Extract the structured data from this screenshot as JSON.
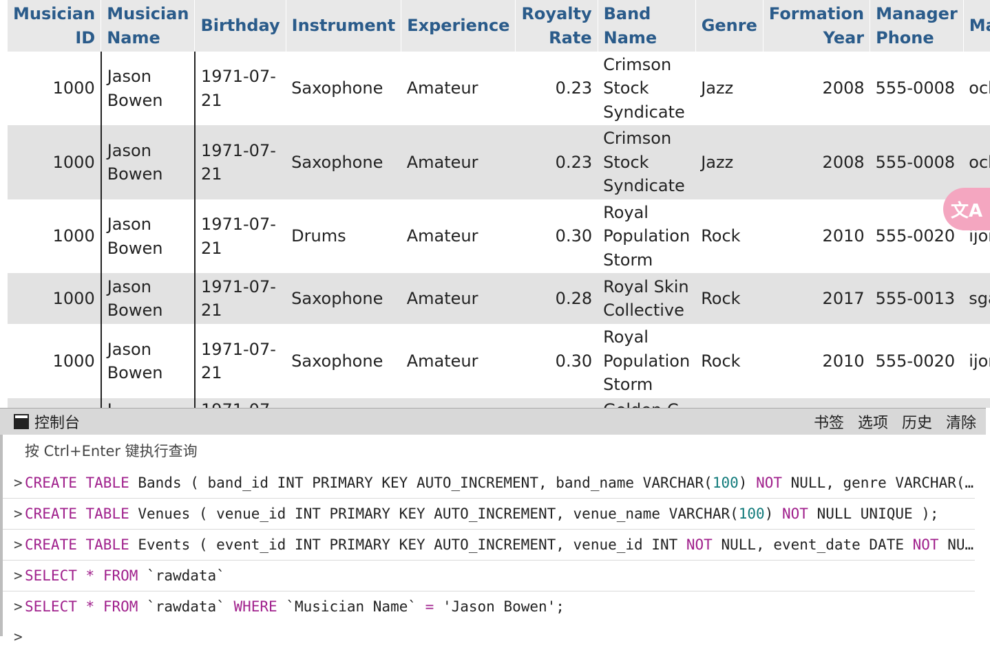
{
  "table": {
    "headers": [
      "Musician ID",
      "Musician Name",
      "Birthday",
      "Instrument",
      "Experience",
      "Royalty Rate",
      "Band Name",
      "Genre",
      "Formation Year",
      "Manager Phone",
      "Ma"
    ],
    "rows": [
      [
        "1000",
        "Jason Bowen",
        "1971-07-21",
        "Saxophone",
        "Amateur",
        "0.23",
        "Crimson Stock Syndicate",
        "Jazz",
        "2008",
        "555-0008",
        "och"
      ],
      [
        "1000",
        "Jason Bowen",
        "1971-07-21",
        "Saxophone",
        "Amateur",
        "0.23",
        "Crimson Stock Syndicate",
        "Jazz",
        "2008",
        "555-0008",
        "och"
      ],
      [
        "1000",
        "Jason Bowen",
        "1971-07-21",
        "Drums",
        "Amateur",
        "0.30",
        "Royal Population Storm",
        "Rock",
        "2010",
        "555-0020",
        "ijor"
      ],
      [
        "1000",
        "Jason Bowen",
        "1971-07-21",
        "Saxophone",
        "Amateur",
        "0.28",
        "Royal Skin Collective",
        "Rock",
        "2017",
        "555-0013",
        "sga"
      ],
      [
        "1000",
        "Jason Bowen",
        "1971-07-21",
        "Saxophone",
        "Amateur",
        "0.30",
        "Royal Population Storm",
        "Rock",
        "2010",
        "555-0020",
        "ijor"
      ],
      [
        "",
        "J",
        "1971-07",
        "",
        "",
        "",
        "Golden C",
        "",
        "",
        "",
        ""
      ]
    ]
  },
  "translate_icon": "translate-icon",
  "console": {
    "title": "控制台",
    "actions": [
      "书签",
      "选项",
      "历史",
      "清除"
    ],
    "hint": "按 Ctrl+Enter 键执行查询",
    "queries": [
      {
        "text": "CREATE TABLE Bands ( band_id INT PRIMARY KEY AUTO_INCREMENT, band_name VARCHAR(100) NOT NULL, genre VARCHAR(…"
      },
      {
        "text": "CREATE TABLE Venues ( venue_id INT PRIMARY KEY AUTO_INCREMENT, venue_name VARCHAR(100) NOT NULL UNIQUE );"
      },
      {
        "text": "CREATE TABLE Events ( event_id INT PRIMARY KEY AUTO_INCREMENT, venue_id INT NOT NULL, event_date DATE NOT NU…"
      },
      {
        "text": "SELECT * FROM `rawdata`"
      },
      {
        "text": "SELECT * FROM `rawdata` WHERE `Musician Name` = 'Jason Bowen';"
      }
    ],
    "prompt": ">"
  },
  "colors": {
    "header_text": "#2a5b8a",
    "keyword": "#a0208c",
    "number": "#107a7a",
    "even_row": "#e2e2e2",
    "translate_button": "#f4a6c0"
  }
}
